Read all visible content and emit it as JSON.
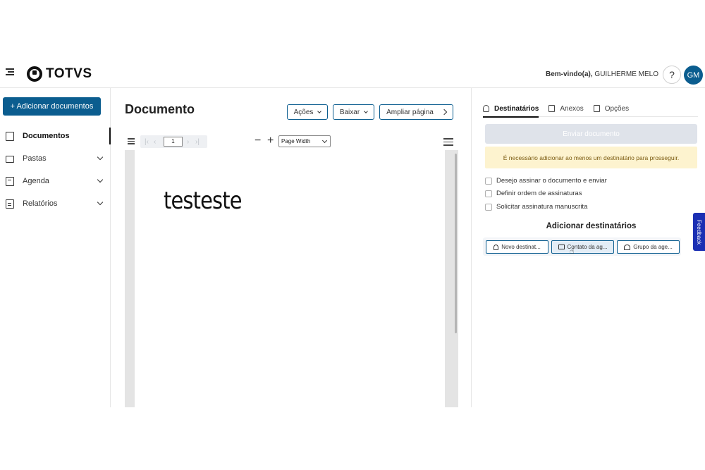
{
  "header": {
    "logo_text": "TOTVS",
    "welcome_label": "Bem-vindo(a),",
    "user_name": "GUILHERME MELO",
    "help_label": "?",
    "avatar_initials": "GM"
  },
  "sidebar": {
    "add_button": "+ Adicionar documentos",
    "items": [
      {
        "label": "Documentos",
        "icon": "document-icon",
        "active": true
      },
      {
        "label": "Pastas",
        "icon": "folder-icon"
      },
      {
        "label": "Agenda",
        "icon": "calendar-icon"
      },
      {
        "label": "Relatórios",
        "icon": "report-icon"
      }
    ]
  },
  "main": {
    "title": "Documento",
    "actions_label": "Ações",
    "download_label": "Baixar",
    "expand_label": "Ampliar página",
    "viewer": {
      "page_number": "1",
      "zoom_value": "Page Width",
      "zoom_out": "−",
      "zoom_in": "+",
      "page_text": "testeste"
    }
  },
  "panel": {
    "tabs": [
      {
        "label": "Destinatários",
        "icon": "person-icon",
        "active": true
      },
      {
        "label": "Anexos",
        "icon": "attachment-icon"
      },
      {
        "label": "Opções",
        "icon": "options-icon"
      }
    ],
    "send_button": "Enviar documento",
    "alert": "É necessário adicionar ao menos um destinatário para prosseguir.",
    "checkboxes": [
      "Desejo assinar o documento e enviar",
      "Definir ordem de assinaturas",
      "Solicitar assinatura manuscrita"
    ],
    "add_recipients_title": "Adicionar destinatários",
    "recipient_buttons": [
      "Novo destinat...",
      "Contato da ag...",
      "Grupo da age..."
    ]
  },
  "feedback_label": "Feedback",
  "colors": {
    "primary": "#0b5d8f",
    "alert_bg": "#fdf3cf",
    "feedback_tab": "#1b2fb3"
  }
}
